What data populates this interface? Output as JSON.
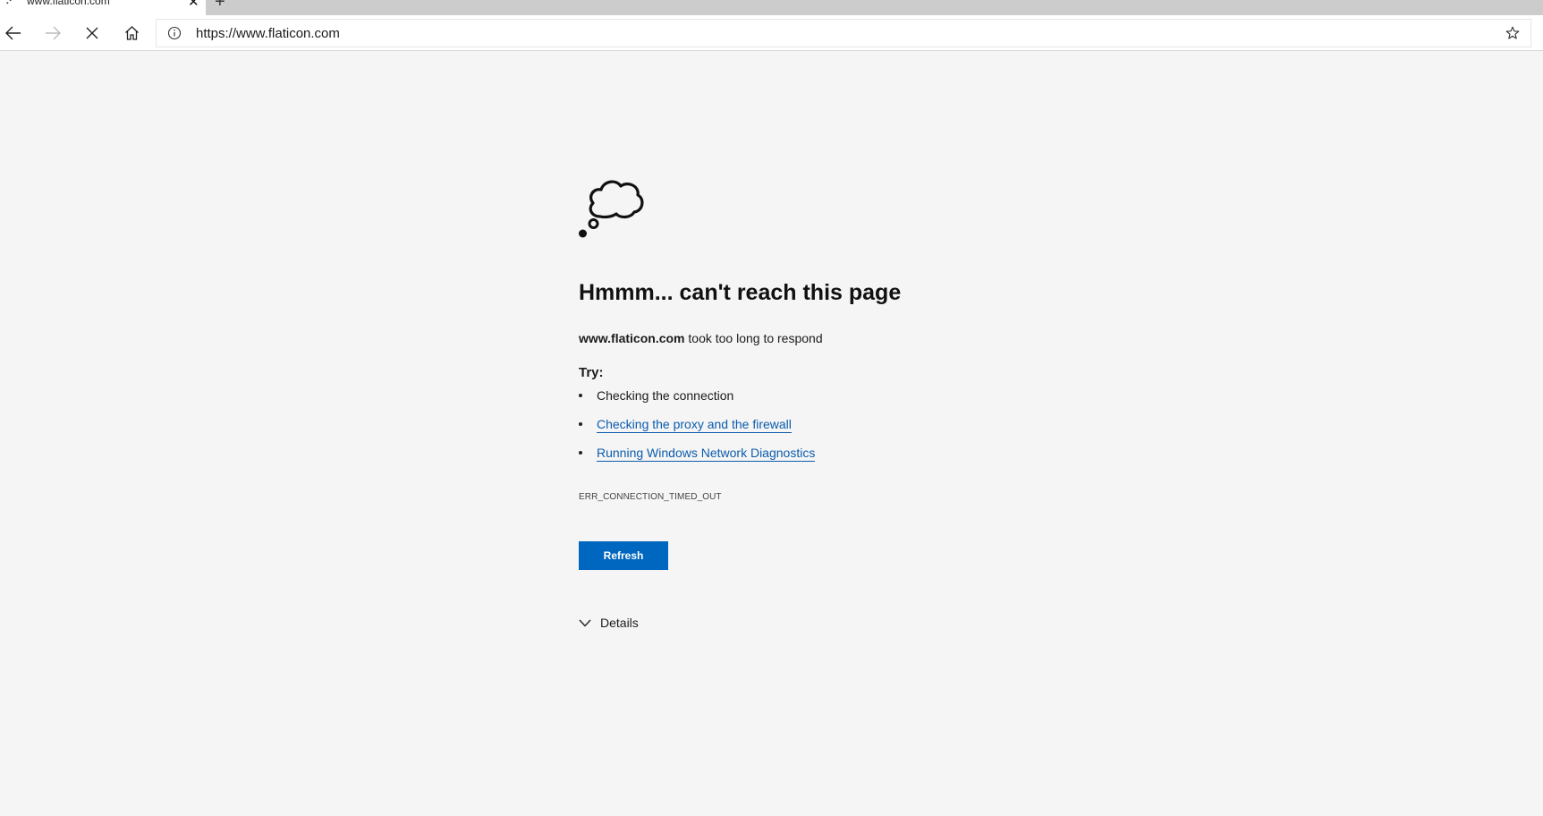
{
  "browser": {
    "tab": {
      "title": "www.flaticon.com",
      "loading_indicator": "⠊"
    },
    "address_bar": {
      "url": "https://www.flaticon.com"
    },
    "icons": {
      "back": "arrow-left-icon",
      "forward": "arrow-right-icon",
      "stop": "close-icon",
      "home": "home-icon",
      "info": "info-icon",
      "favorite": "star-icon",
      "new_tab": "plus-icon",
      "tab_close": "close-icon"
    }
  },
  "error_page": {
    "heading": "Hmmm... can't reach this page",
    "host": "www.flaticon.com",
    "message": " took too long to respond",
    "try_label": "Try:",
    "suggestions": [
      {
        "text": "Checking the connection",
        "is_link": false
      },
      {
        "text": "Checking the proxy and the firewall",
        "is_link": true
      },
      {
        "text": "Running Windows Network Diagnostics",
        "is_link": true
      }
    ],
    "error_code": "ERR_CONNECTION_TIMED_OUT",
    "refresh_label": "Refresh",
    "details_label": "Details"
  },
  "colors": {
    "page_background": "#f5f5f5",
    "link": "#0b5cad",
    "button": "#0067c0",
    "tabstrip": "#cccccc"
  }
}
